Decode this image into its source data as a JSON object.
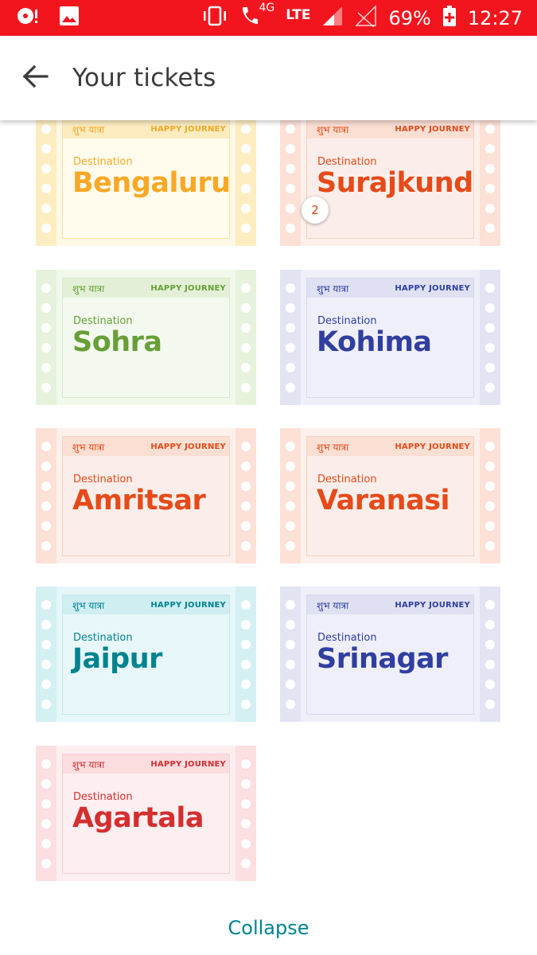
{
  "status_bar": {
    "network_type": "4G",
    "network_label": "LTE",
    "battery": "69%",
    "time": "12:27",
    "icons": [
      "media-sync-icon",
      "image-icon",
      "vibrate-icon",
      "call-icon",
      "signal-icon",
      "signal-empty-icon",
      "battery-charging-icon"
    ]
  },
  "app_bar": {
    "title": "Your tickets",
    "back_icon": "arrow-left-icon"
  },
  "tickets": [
    {
      "hindi": "शुभ यात्रा",
      "happy": "HAPPY JOURNEY",
      "label": "Destination",
      "city": "Bengaluru",
      "theme": {
        "strip": "#fdedc0",
        "body": "#fff8e6",
        "card": "#fffbed",
        "border": "#fbe4a3",
        "header": "#fcecc0",
        "accent": "#f9a825"
      }
    },
    {
      "hindi": "शुभ यात्रा",
      "happy": "HAPPY JOURNEY",
      "label": "Destination",
      "city": "Surajkund",
      "count": "2",
      "theme": {
        "strip": "#fde0d6",
        "body": "#fdf0ea",
        "card": "#fbeeea",
        "border": "#f6d1c5",
        "header": "#fbdfd3",
        "accent": "#e64a19"
      }
    },
    {
      "hindi": "शुभ यात्रा",
      "happy": "HAPPY JOURNEY",
      "label": "Destination",
      "city": "Sohra",
      "theme": {
        "strip": "#e6f2dc",
        "body": "#f2f8ec",
        "card": "#f3f9ee",
        "border": "#d9eacb",
        "header": "#e3f0d7",
        "accent": "#689f38"
      }
    },
    {
      "hindi": "शुभ यात्रा",
      "happy": "HAPPY JOURNEY",
      "label": "Destination",
      "city": "Kohima",
      "theme": {
        "strip": "#e2e4f4",
        "body": "#eeeff9",
        "card": "#efeffa",
        "border": "#d6d8ef",
        "header": "#dfe1f2",
        "accent": "#303f9f"
      }
    },
    {
      "hindi": "शुभ यात्रा",
      "happy": "HAPPY JOURNEY",
      "label": "Destination",
      "city": "Amritsar",
      "theme": {
        "strip": "#fde0d6",
        "body": "#fdf0ea",
        "card": "#fbeeea",
        "border": "#f6d1c5",
        "header": "#fbdfd3",
        "accent": "#e64a19"
      }
    },
    {
      "hindi": "शुभ यात्रा",
      "happy": "HAPPY JOURNEY",
      "label": "Destination",
      "city": "Varanasi",
      "theme": {
        "strip": "#fde0d6",
        "body": "#fdf0ea",
        "card": "#fbeeea",
        "border": "#f6d1c5",
        "header": "#fbdfd3",
        "accent": "#e64a19"
      }
    },
    {
      "hindi": "शुभ यात्रा",
      "happy": "HAPPY JOURNEY",
      "label": "Destination",
      "city": "Jaipur",
      "theme": {
        "strip": "#d4f0f3",
        "body": "#e6f7f9",
        "card": "#e8f7fa",
        "border": "#c3e8ed",
        "header": "#cfeef2",
        "accent": "#00838f"
      }
    },
    {
      "hindi": "शुभ यात्रा",
      "happy": "HAPPY JOURNEY",
      "label": "Destination",
      "city": "Srinagar",
      "theme": {
        "strip": "#e2e4f4",
        "body": "#eeeff9",
        "card": "#efeffa",
        "border": "#d6d8ef",
        "header": "#dfe1f2",
        "accent": "#303f9f"
      }
    },
    {
      "hindi": "शुभ यात्रा",
      "happy": "HAPPY JOURNEY",
      "label": "Destination",
      "city": "Agartala",
      "theme": {
        "strip": "#fcdfe1",
        "body": "#fdeef0",
        "card": "#fdeef0",
        "border": "#f5d0d4",
        "header": "#fbdcdf",
        "accent": "#d32f2f"
      }
    }
  ],
  "collapse_label": "Collapse"
}
